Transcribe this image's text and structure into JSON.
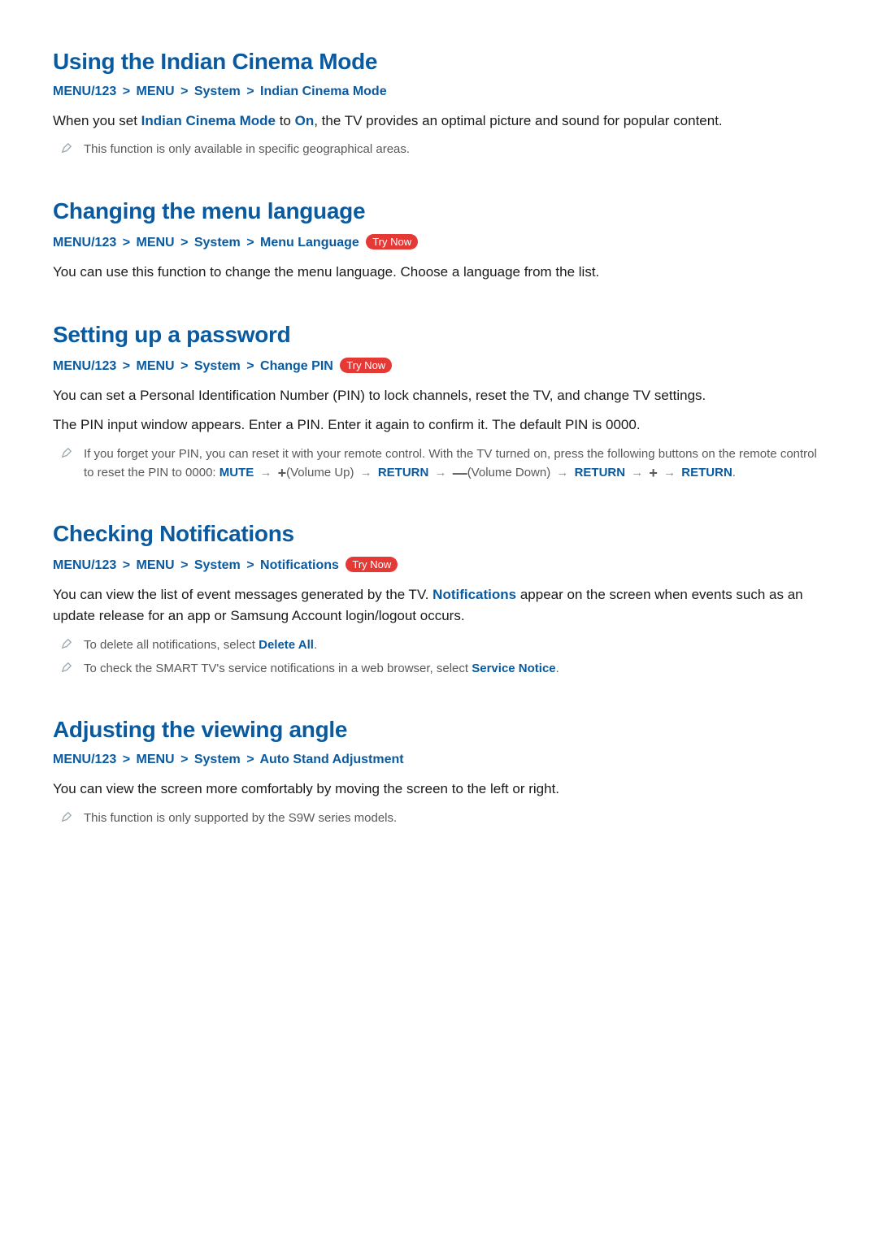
{
  "trynow_label": "Try Now",
  "bc": {
    "p0": "MENU/123",
    "p1": "MENU",
    "p2": "System"
  },
  "s1": {
    "heading": "Using the Indian Cinema Mode",
    "bc_last": "Indian Cinema Mode",
    "body_pre": "When you set ",
    "body_mode": "Indian Cinema Mode",
    "body_mid": " to ",
    "body_on": "On",
    "body_post": ", the TV provides an optimal picture and sound for popular content.",
    "note1": "This function is only available in specific geographical areas."
  },
  "s2": {
    "heading": "Changing the menu language",
    "bc_last": "Menu Language",
    "body": "You can use this function to change the menu language. Choose a language from the list."
  },
  "s3": {
    "heading": "Setting up a password",
    "bc_last": "Change PIN",
    "body1": "You can set a Personal Identification Number (PIN) to lock channels, reset the TV, and change TV settings.",
    "body2": "The PIN input window appears. Enter a PIN. Enter it again to confirm it. The default PIN is 0000.",
    "note_pre": "If you forget your PIN, you can reset it with your remote control. With the TV turned on, press the following buttons on the remote control to reset the PIN to 0000: ",
    "note_mute": "MUTE",
    "note_volup": "(Volume Up)",
    "note_return": "RETURN",
    "note_voldown": "(Volume Down)",
    "note_period": "."
  },
  "s4": {
    "heading": "Checking Notifications",
    "bc_last": "Notifications",
    "body_pre": "You can view the list of event messages generated by the TV. ",
    "body_notif": "Notifications",
    "body_post": " appear on the screen when events such as an update release for an app or Samsung Account login/logout occurs.",
    "note1_pre": "To delete all notifications, select ",
    "note1_bold": "Delete All",
    "note1_post": ".",
    "note2_pre": "To check the SMART TV's service notifications in a web browser, select ",
    "note2_bold": "Service Notice",
    "note2_post": "."
  },
  "s5": {
    "heading": "Adjusting the viewing angle",
    "bc_last": "Auto Stand Adjustment",
    "body": "You can view the screen more comfortably by moving the screen to the left or right.",
    "note1": "This function is only supported by the S9W series models."
  }
}
